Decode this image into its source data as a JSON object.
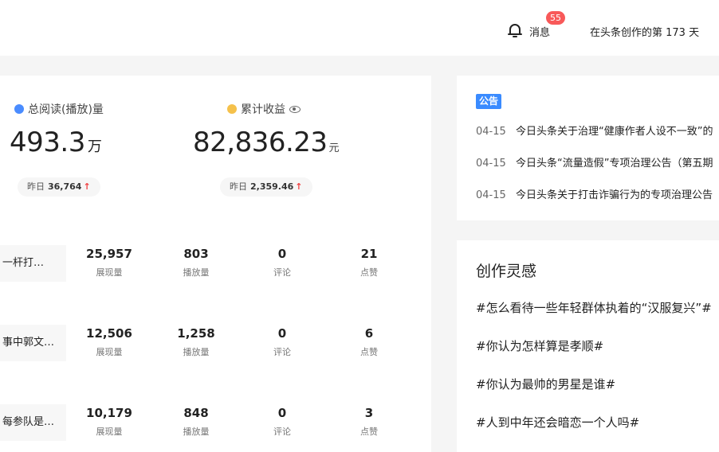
{
  "header": {
    "notifications_label": "消息",
    "notifications_count": "55",
    "creation_days_text": "在头条创作的第 173 天"
  },
  "metrics": {
    "reads": {
      "title": "总阅读(播放)量",
      "value": "493.3",
      "unit": "万",
      "yesterday_label": "昨日",
      "yesterday_value": "36,764",
      "trend": "↑"
    },
    "earnings": {
      "title": "累计收益",
      "value": "82,836.23",
      "unit": "元",
      "yesterday_label": "昨日",
      "yesterday_value": "2,359.46",
      "trend": "↑"
    }
  },
  "articles": [
    {
      "title": "一杆打…",
      "stats": [
        {
          "value": "25,957",
          "label": "展现量"
        },
        {
          "value": "803",
          "label": "播放量"
        },
        {
          "value": "0",
          "label": "评论"
        },
        {
          "value": "21",
          "label": "点赞"
        }
      ]
    },
    {
      "title": "事中郭文…",
      "stats": [
        {
          "value": "12,506",
          "label": "展现量"
        },
        {
          "value": "1,258",
          "label": "播放量"
        },
        {
          "value": "0",
          "label": "评论"
        },
        {
          "value": "6",
          "label": "点赞"
        }
      ]
    },
    {
      "title": "每参队是…",
      "stats": [
        {
          "value": "10,179",
          "label": "展现量"
        },
        {
          "value": "848",
          "label": "播放量"
        },
        {
          "value": "0",
          "label": "评论"
        },
        {
          "value": "3",
          "label": "点赞"
        }
      ]
    }
  ],
  "notice": {
    "tag": "公告",
    "items": [
      {
        "date": "04-15",
        "text": "今日头条关于治理“健康作者人设不一致”的"
      },
      {
        "date": "04-15",
        "text": "今日头条“流量造假”专项治理公告（第五期"
      },
      {
        "date": "04-15",
        "text": "今日头条关于打击诈骗行为的专项治理公告"
      }
    ]
  },
  "inspiration": {
    "title": "创作灵感",
    "topics": [
      "#怎么看待一些年轻群体执着的“汉服复兴”#",
      "#你认为怎样算是孝顺#",
      "#你认为最帅的男星是谁#",
      "#人到中年还会暗恋一个人吗#"
    ]
  },
  "colors": {
    "accent_blue": "#3a8bff",
    "badge_red": "#f85959",
    "up_red": "#f04142"
  }
}
